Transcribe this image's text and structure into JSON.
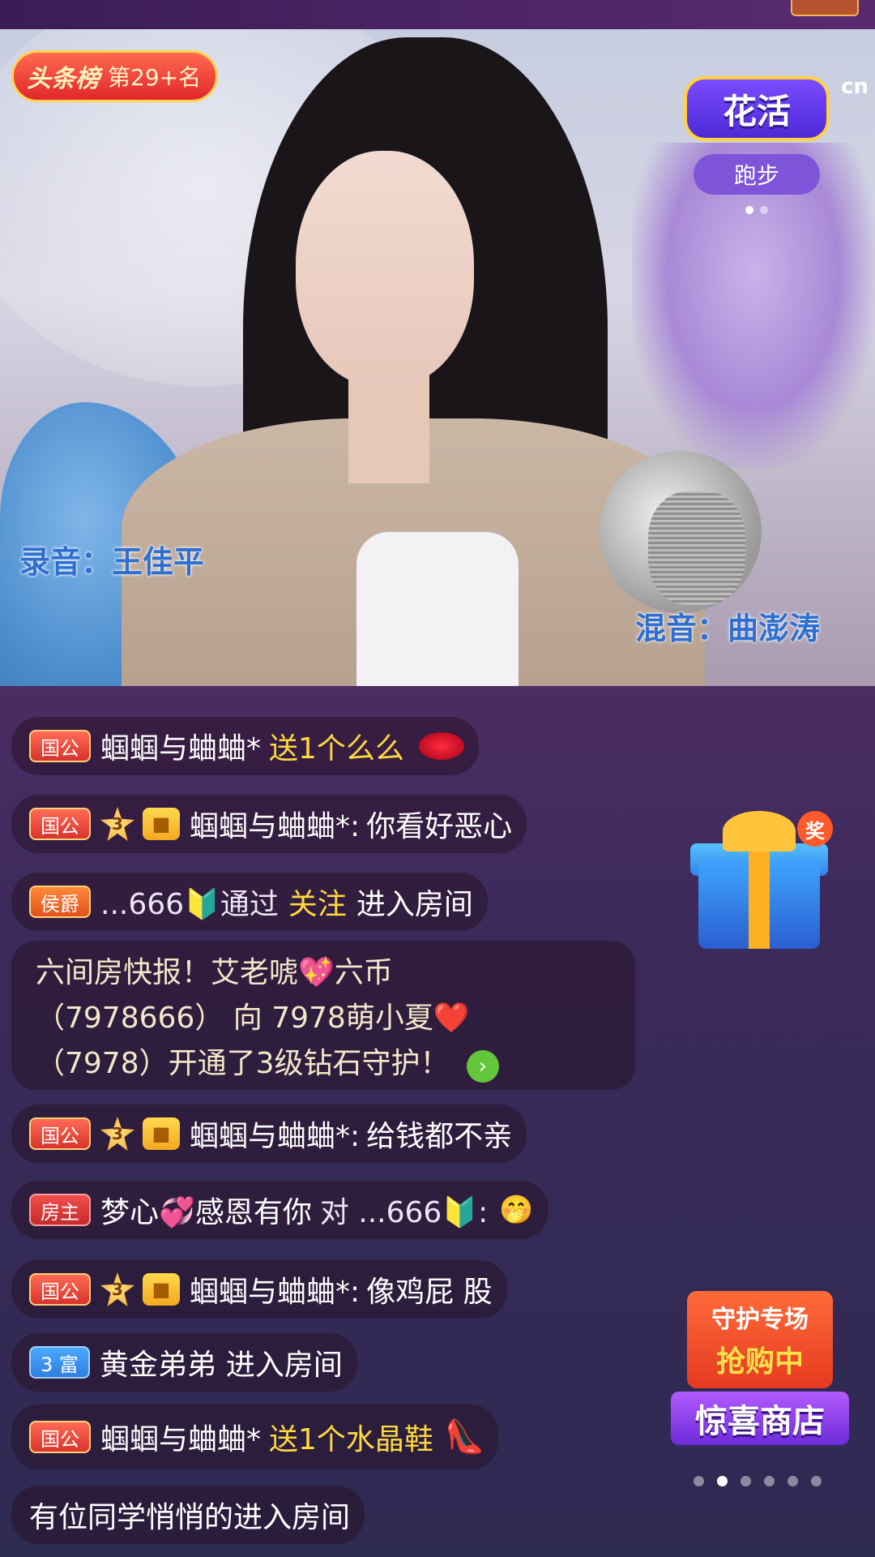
{
  "stream": {
    "headline_badge": {
      "title": "头条榜",
      "rank": "第29+名"
    },
    "activity": {
      "title": "花活",
      "subtitle": "跑步"
    },
    "watermark": "cn",
    "recording_credit": "录音：王佳平",
    "mixing_credit": "混音：曲澎涛"
  },
  "chat": [
    {
      "badge": "国公",
      "user": "蝈蝈与蛐蛐*",
      "action": "送1个么么",
      "gift": "kiss"
    },
    {
      "badge": "国公",
      "level": "3",
      "user": "蝈蝈与蛐蛐*:",
      "text": "你看好恶心"
    },
    {
      "badge": "侯爵",
      "user": "...666🔰通过",
      "highlight": "关注",
      "text": "进入房间"
    },
    {
      "news_line1": "六间房快报！艾老唬💖六币",
      "news_line2": "（7978666） 向  7978萌小夏❤️",
      "news_line3": "（7978）开通了3级钻石守护！"
    },
    {
      "badge": "国公",
      "level": "3",
      "user": "蝈蝈与蛐蛐*:",
      "text": "给钱都不亲"
    },
    {
      "badge": "房主",
      "user": "梦心💞感恩有你",
      "text": "对 ...666🔰:",
      "emoji": "🤭"
    },
    {
      "badge": "国公",
      "level": "3",
      "user": "蝈蝈与蛐蛐*:",
      "text": "像鸡屁  股"
    },
    {
      "badge": "3 富",
      "user": "黄金弟弟",
      "text": "进入房间"
    },
    {
      "badge": "国公",
      "user": "蝈蝈与蛐蛐*",
      "action": "送1个水晶鞋",
      "gift": "crystal-shoe"
    },
    {
      "text": "有位同学悄悄的进入房间"
    }
  ],
  "side": {
    "gift_tag": "奖",
    "shop_line1": "守护专场",
    "shop_line2": "抢购中",
    "shop_name": "惊喜商店"
  },
  "colors": {
    "accent_yellow": "#ffd83f",
    "badge_red": "#d8332c",
    "badge_blue": "#2f7fe0"
  }
}
